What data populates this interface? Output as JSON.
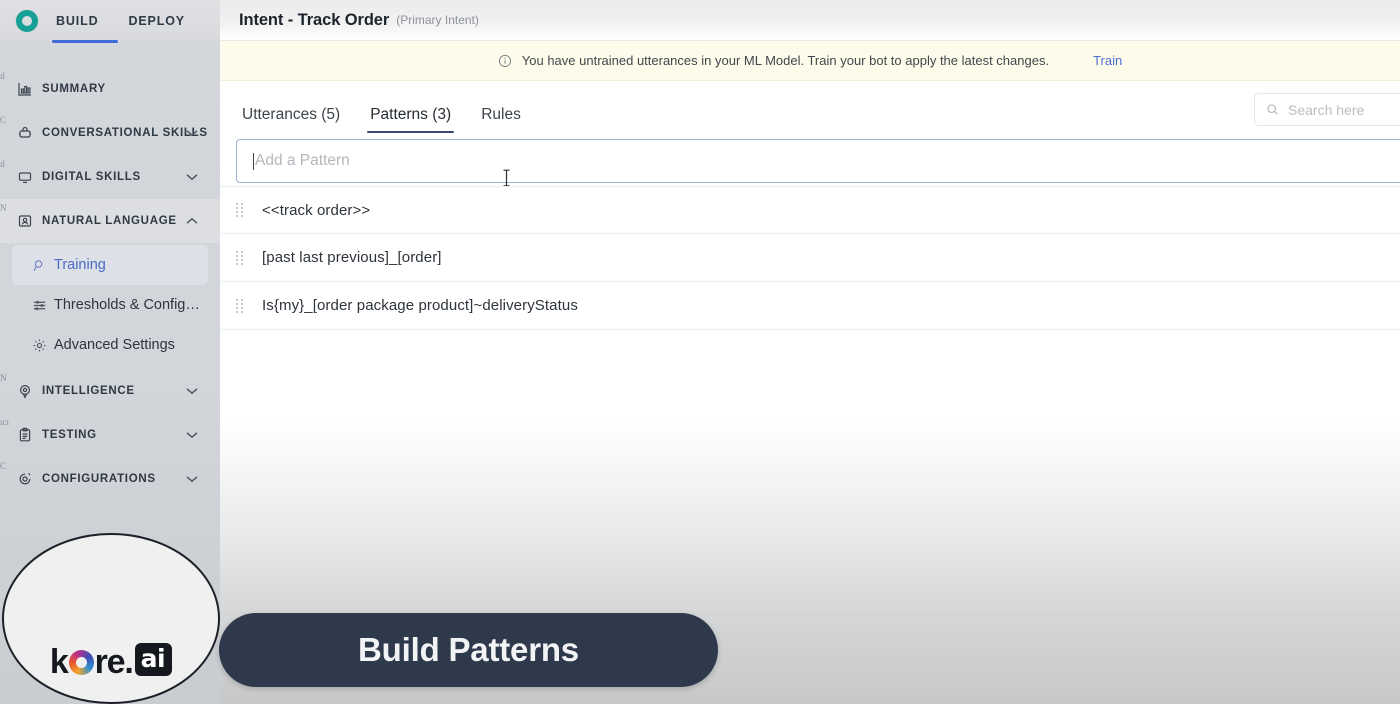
{
  "topnav": {
    "logo_icon": "kore-ring-logo",
    "items": [
      {
        "label": "BUILD",
        "active": true
      },
      {
        "label": "DEPLOY",
        "active": false
      }
    ]
  },
  "sidebar": {
    "sections": [
      {
        "label": "SUMMARY",
        "icon": "chart-bar-icon",
        "chevron": null,
        "ghost": "ıl"
      },
      {
        "label": "CONVERSATIONAL SKILLS",
        "icon": "chat-robot-icon",
        "chevron": "down",
        "ghost": "C"
      },
      {
        "label": "DIGITAL SKILLS",
        "icon": "monitor-icon",
        "chevron": "down",
        "ghost": "ıl"
      },
      {
        "label": "NATURAL LANGUAGE",
        "icon": "person-frame-icon",
        "chevron": "up",
        "ghost": "N"
      },
      {
        "label": "INTELLIGENCE",
        "icon": "target-pin-icon",
        "chevron": "down",
        "ghost": "N"
      },
      {
        "label": "TESTING",
        "icon": "clipboard-icon",
        "chevron": "down",
        "ghost": "ıcı"
      },
      {
        "label": "CONFIGURATIONS",
        "icon": "gear-chat-icon",
        "chevron": "down",
        "ghost": "C"
      }
    ],
    "natural_language_children": [
      {
        "label": "Training",
        "icon": "magnifier-icon",
        "active": true
      },
      {
        "label": "Thresholds & Configu...",
        "icon": "sliders-icon",
        "active": false
      },
      {
        "label": "Advanced Settings",
        "icon": "gear-icon",
        "active": false
      }
    ]
  },
  "header": {
    "title": "Intent - Track Order",
    "subtitle": "(Primary Intent)"
  },
  "alert": {
    "icon": "info-circle-icon",
    "message": "You have untrained utterances in your ML Model. Train your bot to apply the latest changes.",
    "action_label": "Train"
  },
  "tabs": [
    {
      "label": "Utterances (5)",
      "active": false
    },
    {
      "label": "Patterns (3)",
      "active": true
    },
    {
      "label": "Rules",
      "active": false
    }
  ],
  "search": {
    "icon": "search-icon",
    "value": "",
    "placeholder": "Search here"
  },
  "add_pattern": {
    "placeholder": "Add a Pattern",
    "value": "",
    "focused": true
  },
  "patterns": [
    {
      "handle_icon": "drag-handle-icon",
      "text": "<<track order>>"
    },
    {
      "handle_icon": "drag-handle-icon",
      "text": "[past last previous]_[order]"
    },
    {
      "handle_icon": "drag-handle-icon",
      "text": "Is{my}_[order package product]~deliveryStatus"
    }
  ],
  "overlay": {
    "logo_word": "kore",
    "logo_dot": ".",
    "logo_chip": "ai",
    "caption": "Build Patterns"
  },
  "colors": {
    "accent_blue": "#3f6bd6",
    "link_blue": "#4d6fd0",
    "tab_underline": "#3a4a74",
    "brand_teal": "#17a095",
    "alert_bg": "#fdfbe9",
    "sidebar_bg": "#d3d6db",
    "caption_pill": "#2e3a4c"
  }
}
